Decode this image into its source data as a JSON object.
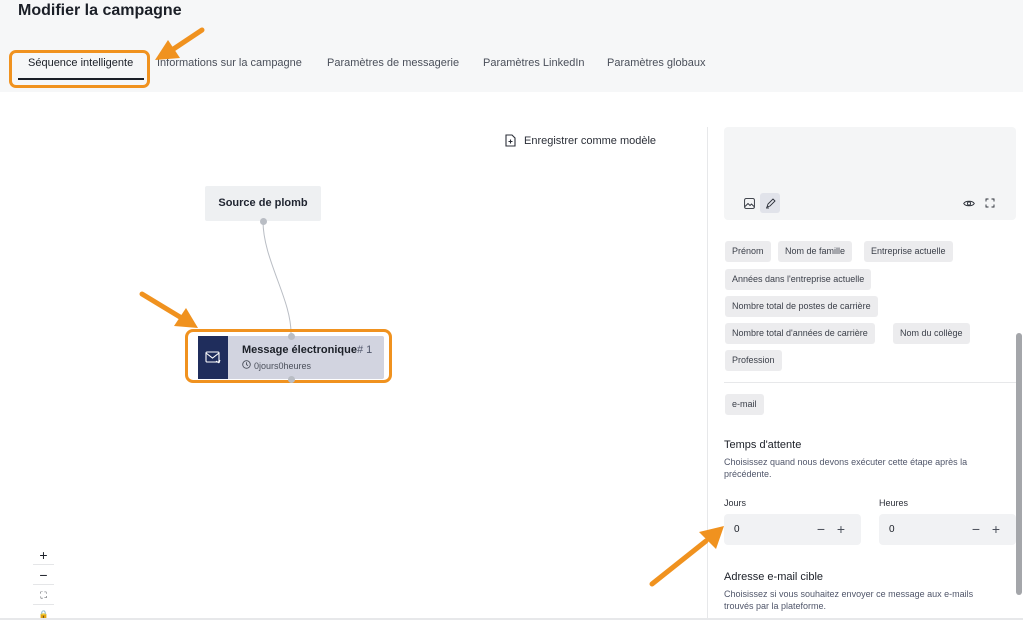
{
  "header": {
    "title": "Modifier la campagne",
    "tabs": [
      {
        "label": "Séquence intelligente"
      },
      {
        "label": "Informations sur la campagne"
      },
      {
        "label": "Paramètres de messagerie"
      },
      {
        "label": "Paramètres LinkedIn"
      },
      {
        "label": "Paramètres globaux"
      }
    ],
    "active_tab": "Séquence intelligente"
  },
  "canvas": {
    "save_template_label": "Enregistrer comme modèle",
    "source_node": {
      "label": "Source de plomb"
    },
    "message_node": {
      "title": "Message électronique",
      "number": "# 1",
      "delay": "0jours0heures",
      "icon": "email-send-icon"
    },
    "zoom_controls": [
      {
        "symbol": "+",
        "name": "zoom-in"
      },
      {
        "symbol": "−",
        "name": "zoom-out"
      },
      {
        "symbol": "⛶",
        "name": "fit-view"
      },
      {
        "symbol": "🔒",
        "name": "lock"
      }
    ]
  },
  "panel": {
    "editor_tools": [
      "image-icon",
      "pencil-icon",
      "eye-icon",
      "expand-icon"
    ],
    "variables": [
      "Prénom",
      "Nom de famille",
      "Entreprise actuelle",
      "Années dans l'entreprise actuelle",
      "Nombre total de postes de carrière",
      "Nombre total d'années de carrière",
      "Nom du collège",
      "Profession"
    ],
    "email_tag": "e-mail",
    "wait_time": {
      "title": "Temps d'attente",
      "description": "Choisissez quand nous devons exécuter cette étape après la précédente.",
      "days_label": "Jours",
      "days_value": "0",
      "hours_label": "Heures",
      "hours_value": "0",
      "minus": "−",
      "plus": "+"
    },
    "target_email": {
      "title": "Adresse e-mail cible",
      "description": "Choisissez si vous souhaitez envoyer ce message aux e-mails trouvés par la plateforme."
    }
  },
  "colors": {
    "accent_highlight": "#f0921f",
    "node_icon_bg": "#1f2d5c",
    "node_bg": "#d2d4e0"
  }
}
